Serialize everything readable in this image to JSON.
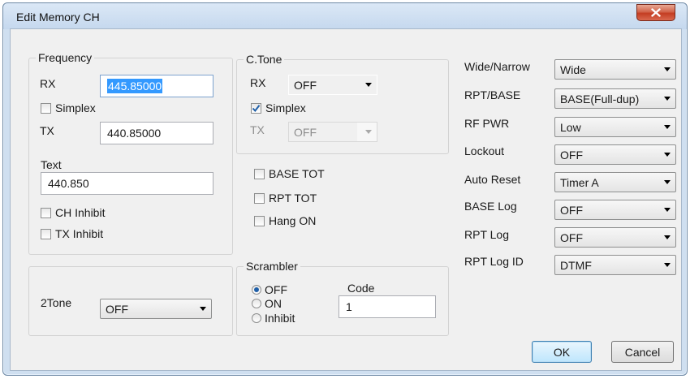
{
  "window": {
    "title": "Edit Memory CH",
    "close_glyph": "x"
  },
  "frequency": {
    "title": "Frequency",
    "rx_label": "RX",
    "rx_value": "445.85000",
    "simplex_label": "Simplex",
    "simplex_checked": false,
    "tx_label": "TX",
    "tx_value": "440.85000",
    "text_label": "Text",
    "text_value": "440.850",
    "ch_inhibit_label": "CH Inhibit",
    "tx_inhibit_label": "TX Inhibit"
  },
  "ctone": {
    "title": "C.Tone",
    "rx_label": "RX",
    "rx_value": "OFF",
    "simplex_label": "Simplex",
    "simplex_checked": true,
    "tx_label": "TX",
    "tx_value": "OFF"
  },
  "misc_checks": {
    "base_tot": "BASE TOT",
    "rpt_tot": "RPT TOT",
    "hang_on": "Hang ON"
  },
  "twotone": {
    "label": "2Tone",
    "value": "OFF"
  },
  "scrambler": {
    "title": "Scrambler",
    "off": "OFF",
    "on": "ON",
    "inhibit": "Inhibit",
    "selected": "OFF",
    "code_label": "Code",
    "code_value": "1"
  },
  "settings": [
    {
      "label": "Wide/Narrow",
      "value": "Wide"
    },
    {
      "label": "RPT/BASE",
      "value": "BASE(Full-dup)"
    },
    {
      "label": "RF PWR",
      "value": "Low"
    },
    {
      "label": "Lockout",
      "value": "OFF"
    },
    {
      "label": "Auto Reset",
      "value": "Timer A"
    },
    {
      "label": "BASE Log",
      "value": "OFF"
    },
    {
      "label": "RPT Log",
      "value": "OFF"
    },
    {
      "label": "RPT Log ID",
      "value": "DTMF"
    }
  ],
  "buttons": {
    "ok": "OK",
    "cancel": "Cancel"
  },
  "colors": {
    "title_bar": "#c5d8ee",
    "close": "#c43d22",
    "selection": "#3399ff",
    "check": "#1f5fa8"
  }
}
